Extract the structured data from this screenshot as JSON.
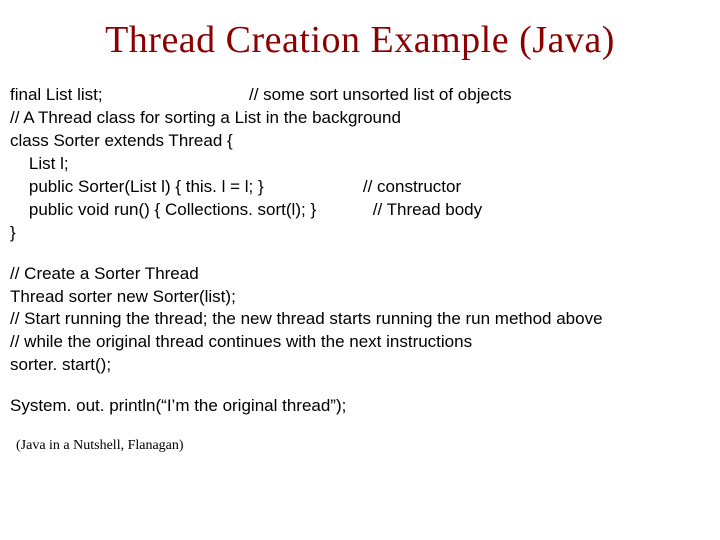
{
  "title": "Thread Creation Example (Java)",
  "code": {
    "block1": "final List list;                               // some sort unsorted list of objects\n// A Thread class for sorting a List in the background\nclass Sorter extends Thread {\n    List l;\n    public Sorter(List l) { this. l = l; }                     // constructor\n    public void run() { Collections. sort(l); }            // Thread body\n}",
    "block2": "// Create a Sorter Thread\nThread sorter new Sorter(list);\n// Start running the thread; the new thread starts running the run method above\n// while the original thread continues with the next instructions\nsorter. start();",
    "block3": "System. out. println(“I’m the original thread”);"
  },
  "citation": "(Java in a Nutshell, Flanagan)"
}
